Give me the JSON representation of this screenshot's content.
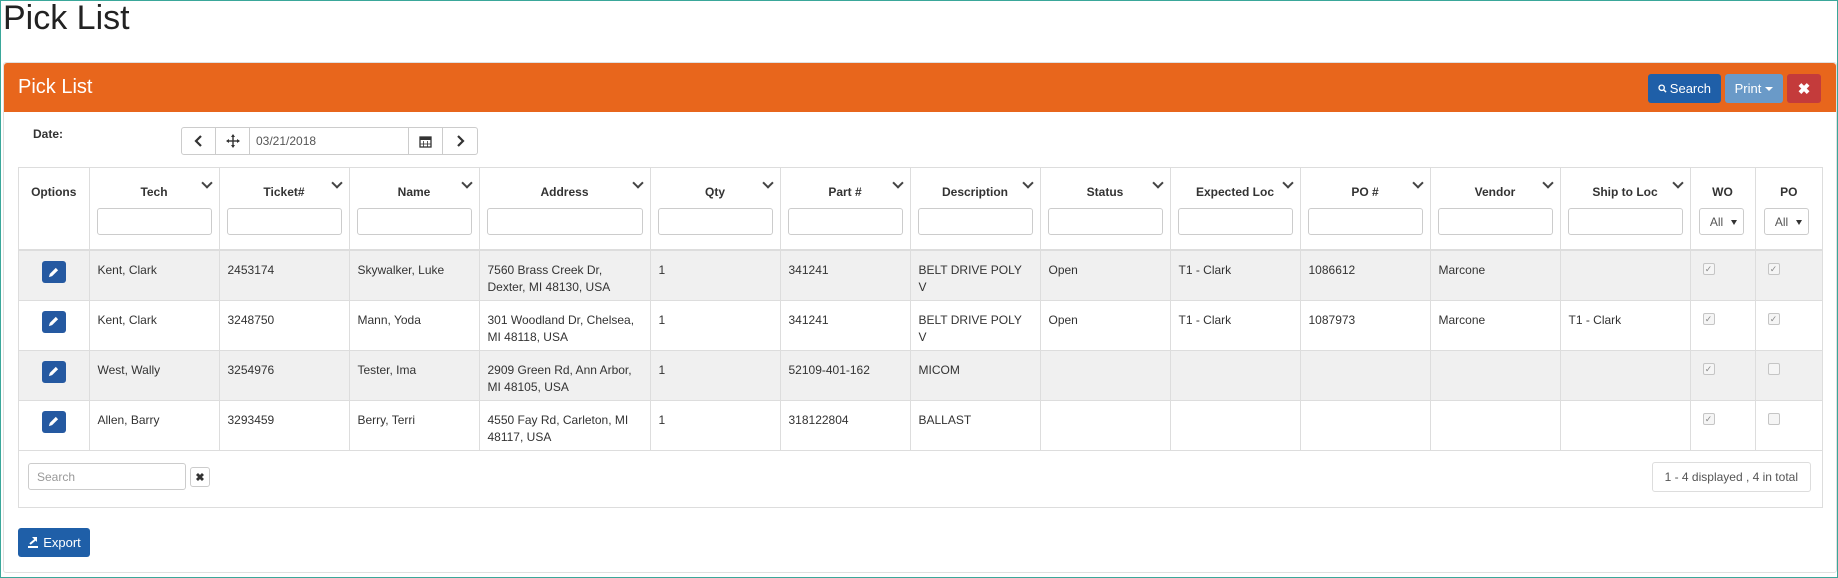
{
  "page": {
    "title": "Pick List"
  },
  "panel": {
    "title": "Pick List",
    "search_label": "Search",
    "print_label": "Print",
    "close_glyph": "✖",
    "accent": "#e8661c"
  },
  "date_filter": {
    "label": "Date:",
    "value": "03/21/2018"
  },
  "table": {
    "columns": [
      {
        "label": "Options"
      },
      {
        "label": "Tech"
      },
      {
        "label": "Ticket#"
      },
      {
        "label": "Name"
      },
      {
        "label": "Address"
      },
      {
        "label": "Qty"
      },
      {
        "label": "Part #"
      },
      {
        "label": "Description"
      },
      {
        "label": "Status"
      },
      {
        "label": "Expected Loc"
      },
      {
        "label": "PO #"
      },
      {
        "label": "Vendor"
      },
      {
        "label": "Ship to Loc"
      },
      {
        "label": "WO",
        "select": "All"
      },
      {
        "label": "PO",
        "select": "All"
      }
    ],
    "rows": [
      {
        "tech": "Kent, Clark",
        "ticket": "2453174",
        "name": "Skywalker, Luke",
        "address": "7560 Brass Creek Dr, Dexter, MI 48130, USA",
        "qty": "1",
        "part": "341241",
        "description": "BELT DRIVE POLY V",
        "status": "Open",
        "expected_loc": "T1 - Clark",
        "po_num": "1086612",
        "vendor": "Marcone",
        "ship_to": "",
        "wo": true,
        "po": true
      },
      {
        "tech": "Kent, Clark",
        "ticket": "3248750",
        "name": "Mann, Yoda",
        "address": "301 Woodland Dr, Chelsea, MI 48118, USA",
        "qty": "1",
        "part": "341241",
        "description": "BELT DRIVE POLY V",
        "status": "Open",
        "expected_loc": "T1 - Clark",
        "po_num": "1087973",
        "vendor": "Marcone",
        "ship_to": "T1 - Clark",
        "wo": true,
        "po": true
      },
      {
        "tech": "West, Wally",
        "ticket": "3254976",
        "name": "Tester, Ima",
        "address": "2909 Green Rd, Ann Arbor, MI 48105, USA",
        "qty": "1",
        "part": "52109-401-162",
        "description": "MICOM",
        "status": "",
        "expected_loc": "",
        "po_num": "",
        "vendor": "",
        "ship_to": "",
        "wo": true,
        "po": false
      },
      {
        "tech": "Allen, Barry",
        "ticket": "3293459",
        "name": "Berry, Terri",
        "address": "4550 Fay Rd, Carleton, MI 48117, USA",
        "qty": "1",
        "part": "318122804",
        "description": "BALLAST",
        "status": "",
        "expected_loc": "",
        "po_num": "",
        "vendor": "",
        "ship_to": "",
        "wo": true,
        "po": false
      }
    ]
  },
  "footer": {
    "search_placeholder": "Search",
    "clear_glyph": "✖",
    "pager_text": "1 - 4 displayed , 4 in total"
  },
  "export_label": "Export",
  "icons": {
    "prev": "chevron-left-icon",
    "today": "move-icon",
    "calendar": "calendar-icon",
    "next": "chevron-right-icon",
    "edit": "pencil-icon",
    "search": "search-icon",
    "export": "export-icon"
  }
}
